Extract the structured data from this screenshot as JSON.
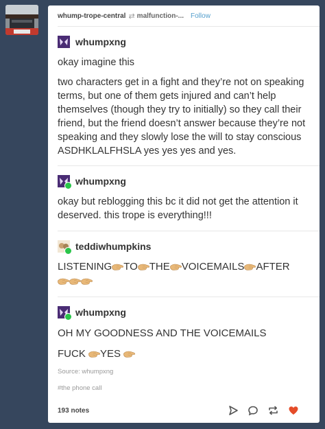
{
  "header": {
    "blog": "whump-trope-central",
    "reblog_from": "malfunction-...",
    "follow_label": "Follow"
  },
  "posts": [
    {
      "user": "whumpxng",
      "paragraphs": [
        "okay imagine this",
        "two characters get in a fight and they’re not on speaking terms, but one of them gets injured and can’t help themselves (though they try to initially) so they call their friend, but the friend doesn’t answer because they’re not speaking and they slowly lose the will to stay conscious ASDHKLALFHSLA yes yes yes and yes."
      ]
    },
    {
      "user": "whumpxng",
      "paragraphs": [
        "okay but reblogging this bc it did not get the attention it deserved. this trope is everything!!!"
      ]
    },
    {
      "user": "teddiwhumpkins",
      "words": [
        "LISTENING",
        "TO",
        "THE",
        "VOICEMAILS",
        "AFTER"
      ]
    },
    {
      "user": "whumpxng",
      "line1": "OH MY GOODNESS AND THE VOICEMAILS",
      "line2_a": "FUCK",
      "line2_b": "YES"
    }
  ],
  "source": "Source: whumpxng",
  "tag": "#the phone call",
  "notes": "193 notes",
  "icons": {
    "share": "send-icon",
    "reply": "reply-icon",
    "reblog": "reblog-icon",
    "like": "heart-icon"
  },
  "colors": {
    "dashboard_bg": "#36465d",
    "link": "#529ecc",
    "like": "#e54c29",
    "badge": "#2ac54a"
  }
}
